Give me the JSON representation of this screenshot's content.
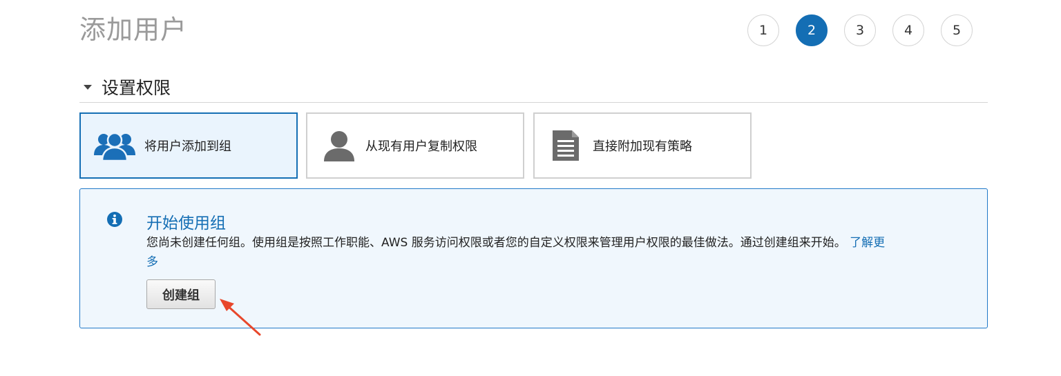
{
  "page": {
    "title": "添加用户"
  },
  "steps": [
    "1",
    "2",
    "3",
    "4",
    "5"
  ],
  "active_step": "2",
  "section": {
    "title": "设置权限"
  },
  "options": [
    {
      "label": "将用户添加到组",
      "icon": "group-icon",
      "selected": true
    },
    {
      "label": "从现有用户复制权限",
      "icon": "user-icon",
      "selected": false
    },
    {
      "label": "直接附加现有策略",
      "icon": "document-icon",
      "selected": false
    }
  ],
  "info": {
    "title": "开始使用组",
    "body": "您尚未创建任何组。使用组是按照工作职能、AWS 服务访问权限或者您的自定义权限来管理用户权限的最佳做法。通过创建组来开始。",
    "link": "了解更多",
    "button": "创建组"
  },
  "colors": {
    "accent": "#146eb4",
    "selected_bg": "#eaf4fd",
    "info_bg": "#f0f7fd",
    "annotation_arrow": "#e8472b"
  }
}
